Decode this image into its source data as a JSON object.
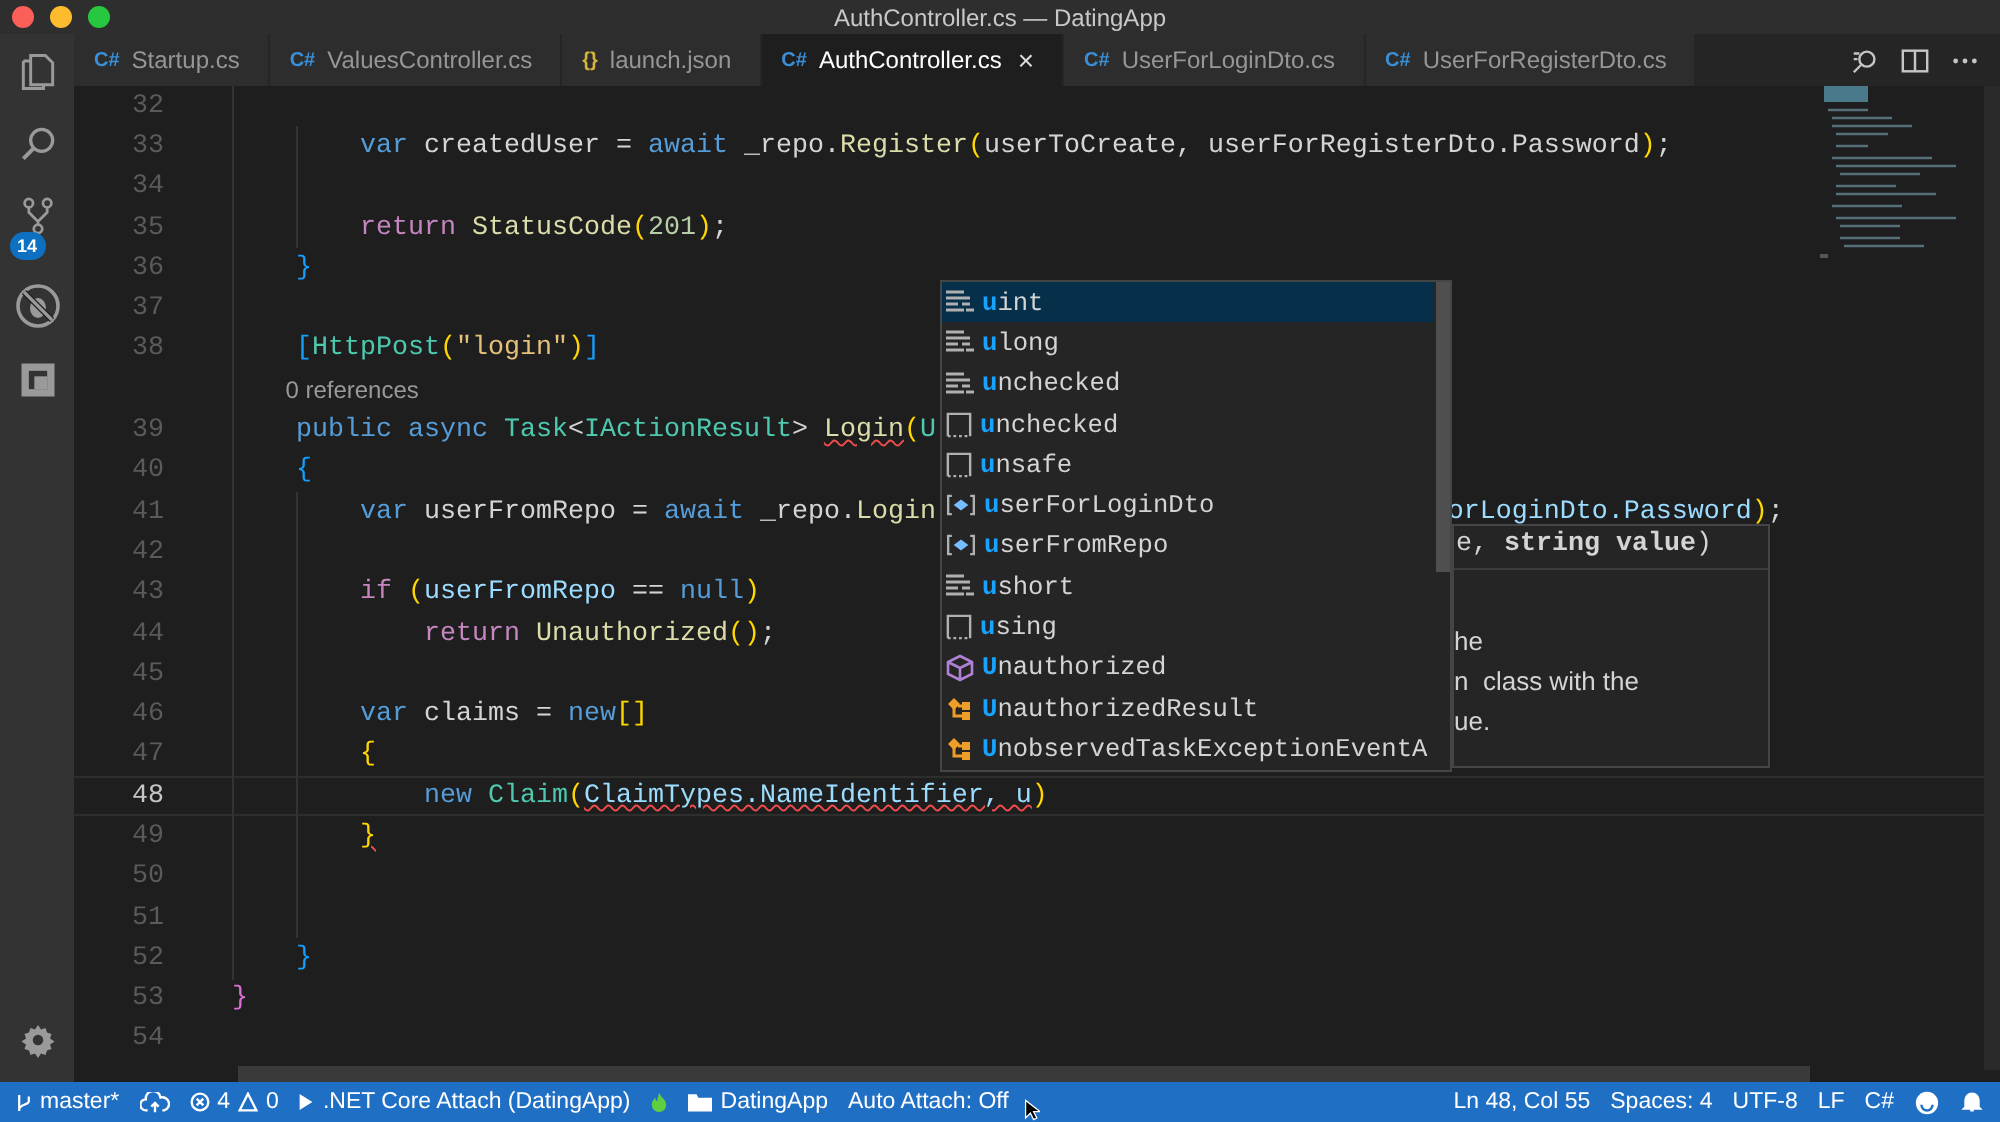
{
  "window": {
    "title": "AuthController.cs — DatingApp"
  },
  "activity_bar": {
    "source_control_badge": "14"
  },
  "tabs": [
    {
      "icon": "C#",
      "kind": "csharp",
      "label": "Startup.cs",
      "selected": false
    },
    {
      "icon": "C#",
      "kind": "csharp",
      "label": "ValuesController.cs",
      "selected": false
    },
    {
      "icon": "{}",
      "kind": "json",
      "label": "launch.json",
      "selected": false
    },
    {
      "icon": "C#",
      "kind": "csharp",
      "label": "AuthController.cs",
      "selected": true,
      "close": "×"
    },
    {
      "icon": "C#",
      "kind": "csharp",
      "label": "UserForLoginDto.cs",
      "selected": false
    },
    {
      "icon": "C#",
      "kind": "csharp",
      "label": "UserForRegisterDto.cs",
      "selected": false
    }
  ],
  "editor": {
    "lines": [
      {
        "children": [
          {
            "children": [
              {
                "number": "32",
                "current": false
              },
              {
                "number": "33",
                "current": false,
                "tokens": [
                  {
                    "kind": "kw",
                    "text": "var"
                  },
                  {
                    "kind": "plain",
                    "text": " createdUser = "
                  },
                  {
                    "kind": "kw",
                    "text": "await"
                  },
                  {
                    "kind": "plain",
                    "text": " _repo."
                  },
                  {
                    "kind": "fn",
                    "text": "Register"
                  },
                  {
                    "kind": "b1",
                    "text": "("
                  },
                  {
                    "kind": "plain",
                    "text": "userToCreate, userForRegisterDto.Password"
                  },
                  {
                    "kind": "b1",
                    "text": ")"
                  },
                  {
                    "kind": "plain",
                    "text": ";"
                  }
                ]
              },
              {
                "number": "34",
                "current": false
              },
              {
                "number": "35",
                "current": false,
                "tokens": [
                  {
                    "kind": "ctl",
                    "text": "return"
                  },
                  {
                    "kind": "fn",
                    "text": " StatusCode"
                  },
                  {
                    "kind": "b1",
                    "text": "("
                  },
                  {
                    "kind": "num",
                    "text": "201"
                  },
                  {
                    "kind": "b1",
                    "text": ")"
                  },
                  {
                    "kind": "plain",
                    "text": ";"
                  }
                ]
              }
            ]
          },
          {
            "number": "36",
            "current": false,
            "tokens": [
              {
                "kind": "b3",
                "text": "}"
              }
            ]
          },
          {
            "number": "37",
            "current": false
          },
          {
            "number": "38",
            "current": false,
            "tokens": [
              {
                "kind": "b3",
                "text": "["
              },
              {
                "kind": "type",
                "text": "HttpPost"
              },
              {
                "kind": "b1",
                "text": "("
              },
              {
                "kind": "str",
                "text": "\"login\""
              },
              {
                "kind": "b1",
                "text": ")"
              },
              {
                "kind": "b3",
                "text": "]"
              }
            ]
          },
          {
            "kind": "codelens",
            "text": "0 references"
          },
          {
            "number": "39",
            "current": false,
            "tokens": [
              {
                "kind": "kw",
                "text": "public async"
              },
              {
                "kind": "type",
                "text": " Task"
              },
              {
                "kind": "plain",
                "text": "<"
              },
              {
                "kind": "type",
                "text": "IActionResult"
              },
              {
                "kind": "plain",
                "text": "> "
              },
              {
                "kind": "fn",
                "text": "Login",
                "error": true
              },
              {
                "kind": "b1",
                "text": "("
              },
              {
                "kind": "type",
                "text": "U"
              }
            ]
          },
          {
            "number": "40",
            "current": false,
            "tokens": [
              {
                "kind": "b3",
                "text": "{"
              }
            ]
          },
          {
            "children": [
              {
                "number": "41",
                "current": false,
                "tokens": [
                  {
                    "kind": "kw",
                    "text": "var"
                  },
                  {
                    "kind": "plain",
                    "text": " userFromRepo = "
                  },
                  {
                    "kind": "kw",
                    "text": "await"
                  },
                  {
                    "kind": "plain",
                    "text": " _repo."
                  },
                  {
                    "kind": "fn",
                    "text": "Login"
                  }
                ],
                "after_popup": [
                  {
                    "kind": "var",
                    "text": "orLoginDto.Password"
                  },
                  {
                    "kind": "b1",
                    "text": ")"
                  },
                  {
                    "kind": "plain",
                    "text": ";"
                  }
                ]
              },
              {
                "number": "42",
                "current": false
              },
              {
                "number": "43",
                "current": false,
                "tokens": [
                  {
                    "kind": "ctl",
                    "text": "if"
                  },
                  {
                    "kind": "b1",
                    "text": " ("
                  },
                  {
                    "kind": "var",
                    "text": "userFromRepo"
                  },
                  {
                    "kind": "plain",
                    "text": " == "
                  },
                  {
                    "kind": "kw",
                    "text": "null"
                  },
                  {
                    "kind": "b1",
                    "text": ")"
                  }
                ]
              },
              {
                "children": [
                  {
                    "number": "44",
                    "current": false,
                    "tokens": [
                      {
                        "kind": "ctl",
                        "text": "return"
                      },
                      {
                        "kind": "fn",
                        "text": " Unauthorized"
                      },
                      {
                        "kind": "b1",
                        "text": "()"
                      },
                      {
                        "kind": "plain",
                        "text": ";"
                      }
                    ]
                  }
                ]
              },
              {
                "number": "45",
                "current": false
              },
              {
                "number": "46",
                "current": false,
                "tokens": [
                  {
                    "kind": "kw",
                    "text": "var"
                  },
                  {
                    "kind": "plain",
                    "text": " claims = "
                  },
                  {
                    "kind": "kw",
                    "text": "new"
                  },
                  {
                    "kind": "b1",
                    "text": "[]"
                  }
                ]
              },
              {
                "number": "47",
                "current": false,
                "tokens": [
                  {
                    "kind": "b1",
                    "text": "{"
                  }
                ]
              },
              {
                "children": [
                  {
                    "number": "48",
                    "current": true,
                    "tokens": [
                      {
                        "kind": "kw",
                        "text": "new"
                      },
                      {
                        "kind": "type",
                        "text": " Claim"
                      },
                      {
                        "kind": "b1",
                        "text": "("
                      },
                      {
                        "kind": "var",
                        "text": "ClaimTypes.NameIdentifier, u",
                        "error": true
                      },
                      {
                        "kind": "b1",
                        "text": ")"
                      }
                    ]
                  }
                ]
              },
              {
                "number": "49",
                "current": false,
                "tokens": [
                  {
                    "kind": "b1",
                    "text": "}",
                    "error": true
                  }
                ]
              },
              {
                "number": "50",
                "current": false
              },
              {
                "number": "51",
                "current": false
              }
            ]
          },
          {
            "number": "52",
            "current": false,
            "tokens": [
              {
                "kind": "b3",
                "text": "}"
              }
            ]
          }
        ]
      },
      {
        "number": "53",
        "current": false,
        "tokens": [
          {
            "kind": "b2",
            "text": "}"
          }
        ]
      },
      {
        "number": "54",
        "current": false
      }
    ]
  },
  "suggestions": [
    {
      "kind": "keyword",
      "label": "uint",
      "selected": true
    },
    {
      "kind": "keyword",
      "label": "ulong",
      "selected": false
    },
    {
      "kind": "keyword",
      "label": "unchecked",
      "selected": false
    },
    {
      "kind": "snippet",
      "label": "unchecked",
      "selected": false
    },
    {
      "kind": "snippet",
      "label": "unsafe",
      "selected": false
    },
    {
      "kind": "variable",
      "label": "userForLoginDto",
      "selected": false
    },
    {
      "kind": "variable",
      "label": "userFromRepo",
      "selected": false
    },
    {
      "kind": "keyword",
      "label": "ushort",
      "selected": false
    },
    {
      "kind": "snippet",
      "label": "using",
      "selected": false
    },
    {
      "kind": "class",
      "label": "Unauthorized",
      "selected": false
    },
    {
      "kind": "event",
      "label": "UnauthorizedResult",
      "selected": false
    },
    {
      "kind": "event",
      "label": "UnobservedTaskExceptionEventA",
      "selected": false
    }
  ],
  "hover": {
    "signature": "e, **string value**)",
    "doc": [
      "he",
      "n  class with the",
      "ue."
    ]
  },
  "status_bar": {
    "branch": "master*",
    "errors": "4",
    "warnings": "0",
    "debug": ".NET Core Attach (DatingApp)",
    "folder": "DatingApp",
    "auto_attach": "Auto Attach: Off",
    "position": "Ln 48, Col 55",
    "spaces": "Spaces: 4",
    "encoding": "UTF-8",
    "eol": "LF",
    "language": "C#"
  }
}
